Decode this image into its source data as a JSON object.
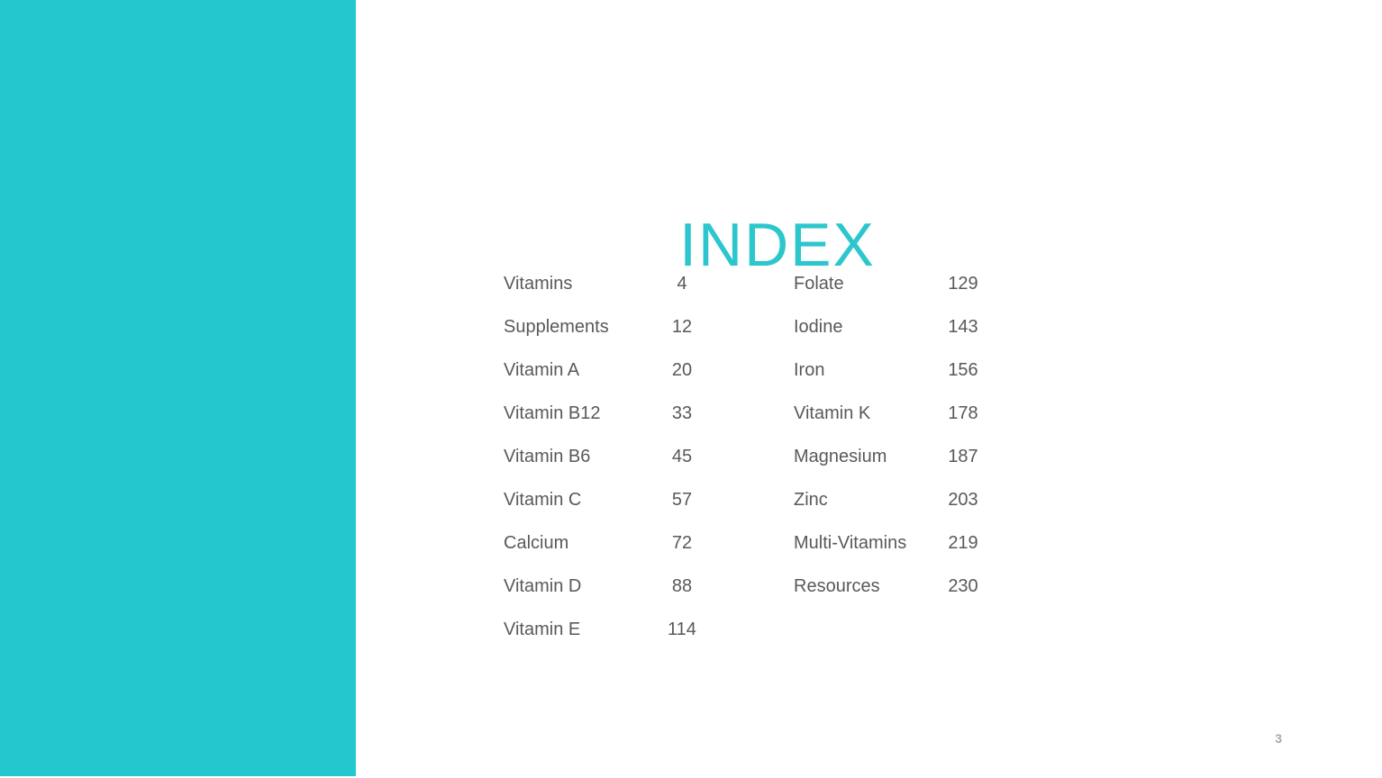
{
  "slide": {
    "title": "INDEX",
    "page_number": "3",
    "accent_color": "#22c8cd",
    "title_color": "#2cc6cd",
    "text_color": "#58595b",
    "page_number_color": "#a6a8ab",
    "background_color": "#ffffff",
    "bottom_rule_color": "#2b2d30"
  },
  "index": {
    "left_column": [
      {
        "label": "Vitamins",
        "page": "4"
      },
      {
        "label": "Supplements",
        "page": "12"
      },
      {
        "label": "Vitamin A",
        "page": "20"
      },
      {
        "label": "Vitamin B12",
        "page": "33"
      },
      {
        "label": "Vitamin B6",
        "page": "45"
      },
      {
        "label": "Vitamin C",
        "page": "57"
      },
      {
        "label": "Calcium",
        "page": "72"
      },
      {
        "label": "Vitamin D",
        "page": "88"
      },
      {
        "label": "Vitamin E",
        "page": "114"
      }
    ],
    "right_column": [
      {
        "label": "Folate",
        "page": "129"
      },
      {
        "label": "Iodine",
        "page": "143"
      },
      {
        "label": "Iron",
        "page": "156"
      },
      {
        "label": "Vitamin K",
        "page": "178"
      },
      {
        "label": "Magnesium",
        "page": "187"
      },
      {
        "label": "Zinc",
        "page": "203"
      },
      {
        "label": "Multi-Vitamins",
        "page": "219"
      },
      {
        "label": "Resources",
        "page": "230"
      }
    ]
  }
}
